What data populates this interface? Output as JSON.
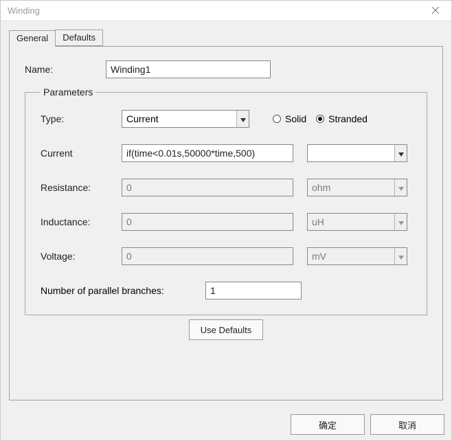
{
  "window": {
    "title": "Winding"
  },
  "tabs": {
    "general": "General",
    "defaults": "Defaults"
  },
  "name": {
    "label": "Name:",
    "value": "Winding1"
  },
  "parameters": {
    "legend": "Parameters",
    "type": {
      "label": "Type:",
      "value": "Current",
      "solid_label": "Solid",
      "stranded_label": "Stranded",
      "selected": "stranded"
    },
    "current": {
      "label": "Current",
      "value": "if(time<0.01s,50000*time,500)",
      "unit": ""
    },
    "resistance": {
      "label": "Resistance:",
      "value": "0",
      "unit": "ohm"
    },
    "inductance": {
      "label": "Inductance:",
      "value": "0",
      "unit": "uH"
    },
    "voltage": {
      "label": "Voltage:",
      "value": "0",
      "unit": "mV"
    },
    "branches": {
      "label": "Number of parallel branches:",
      "value": "1"
    }
  },
  "buttons": {
    "use_defaults": "Use Defaults",
    "ok": "确定",
    "cancel": "取消"
  }
}
